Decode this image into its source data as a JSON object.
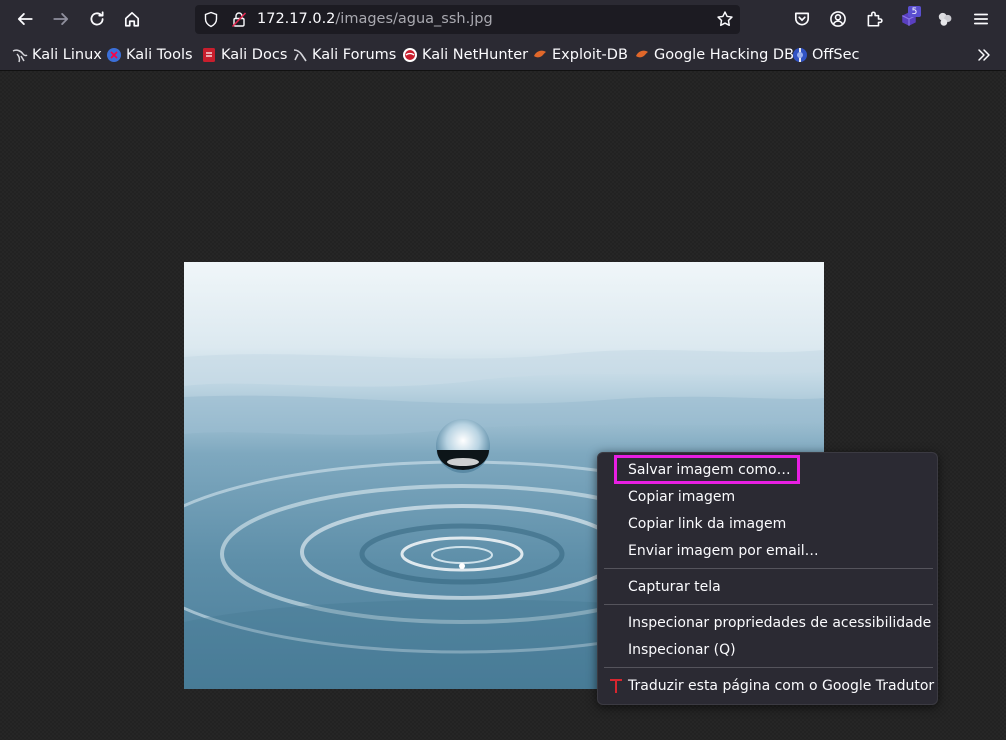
{
  "toolbar": {
    "back_icon": "arrow-left-icon",
    "forward_icon": "arrow-right-icon",
    "reload_icon": "reload-icon",
    "home_icon": "home-icon",
    "url_host": "172.17.0.2",
    "url_path": "/images/agua_ssh.jpg",
    "extension_badge": "5"
  },
  "bookmarks": {
    "items": [
      {
        "label": "Kali Linux",
        "icon": "kali-dragon-icon"
      },
      {
        "label": "Kali Tools",
        "icon": "kali-tools-icon"
      },
      {
        "label": "Kali Docs",
        "icon": "kali-docs-icon"
      },
      {
        "label": "Kali Forums",
        "icon": "kali-forums-icon"
      },
      {
        "label": "Kali NetHunter",
        "icon": "nethunter-icon"
      },
      {
        "label": "Exploit-DB",
        "icon": "exploit-db-icon"
      },
      {
        "label": "Google Hacking DB",
        "icon": "ghdb-icon"
      },
      {
        "label": "OffSec",
        "icon": "offsec-icon"
      }
    ]
  },
  "context_menu": {
    "items": [
      {
        "label": "Salvar imagem como…"
      },
      {
        "label": "Copiar imagem"
      },
      {
        "label": "Copiar link da imagem"
      },
      {
        "label": "Enviar imagem por email…"
      },
      {
        "label": "Capturar tela"
      },
      {
        "label": "Inspecionar propriedades de acessibilidade"
      },
      {
        "label": "Inspecionar (Q)"
      },
      {
        "label": "Traduzir esta página com o Google Tradutor"
      }
    ],
    "highlight_color": "#e81fe3"
  },
  "colors": {
    "toolbar_bg": "#2b2a33",
    "page_bg": "#222222"
  }
}
